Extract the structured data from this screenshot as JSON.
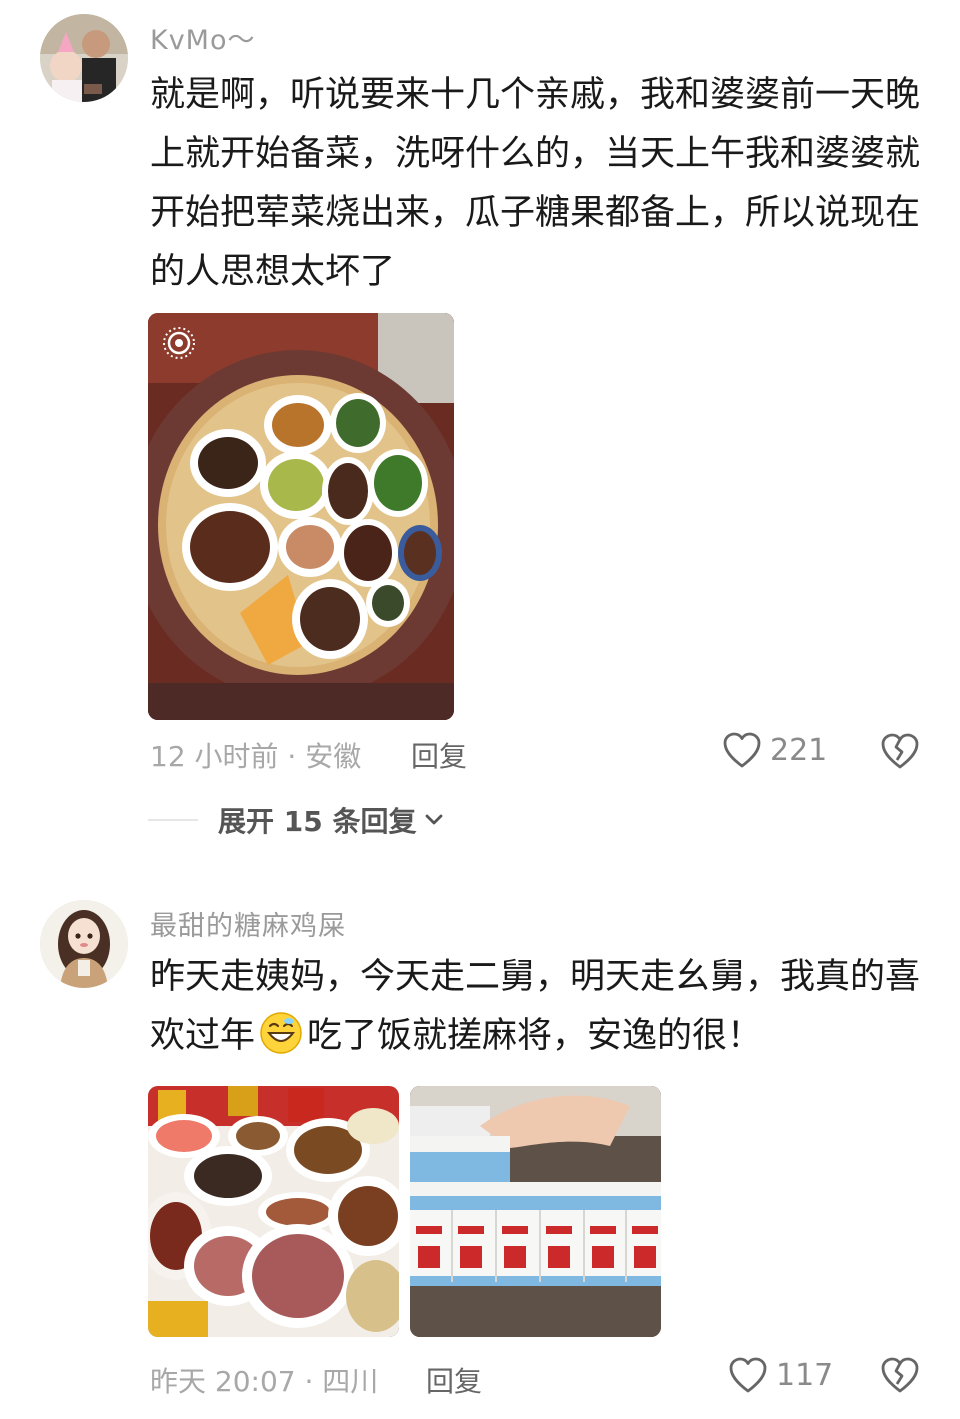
{
  "comments": [
    {
      "username": "KvMo～",
      "text": "就是啊，听说要来十几个亲戚，我和婆婆前一天晚上就开始备菜，洗呀什么的，当天上午我和婆婆就开始把荤菜烧出来，瓜子糖果都备上，所以说现在的人思想太坏了",
      "time_location": "12 小时前 · 安徽",
      "reply_label": "回复",
      "likes": "221",
      "expand_label": "展开 15 条回复"
    },
    {
      "username": "最甜的糖麻鸡屎",
      "text_before": "昨天走姨妈，今天走二舅，明天走幺舅，我真的喜欢过年",
      "text_after": "吃了饭就搓麻将，安逸的很！",
      "time_location": "昨天 20:07 · 四川",
      "reply_label": "回复",
      "likes": "117"
    }
  ],
  "icons": {
    "like": "heart-outline-icon",
    "dislike": "broken-heart-icon",
    "expand": "chevron-down-icon",
    "live_photo": "live-photo-icon",
    "emoji": "grinning-face-emoji"
  },
  "colors": {
    "text_primary": "#1a1a1a",
    "text_secondary": "#a8a8a8",
    "username": "#9a9a9a",
    "icon": "#666666"
  }
}
